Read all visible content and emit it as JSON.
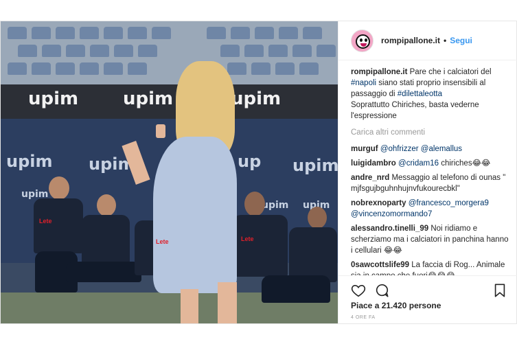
{
  "post": {
    "username": "rompipallone.it",
    "separator": "•",
    "follow_label": "Segui",
    "caption": {
      "username": "rompipallone.it",
      "text_1": "Pare che i calciatori del",
      "hashtag_1": "#napoli",
      "text_2": "siano stati proprio insensibili al passaggio di",
      "hashtag_2": "#dilettaleotta",
      "text_3": "Soprattutto Chiriches, basta vederne l'espressione"
    },
    "load_more_label": "Carica altri commenti",
    "comments": [
      {
        "user": "murguf",
        "mentions": [
          "@ohfrizzer",
          "@alemallus"
        ],
        "text": ""
      },
      {
        "user": "luigidambro",
        "mentions": [
          "@cridam16"
        ],
        "text": "chiriches😂😂"
      },
      {
        "user": "andre_nrd",
        "mentions": [],
        "text": "Messaggio al telefono di ounas \" mjfsgujbguhnhujnvfukourecbkl\""
      },
      {
        "user": "nobrexnoparty",
        "mentions": [
          "@francesco_morgera9",
          "@vincenzomormando7"
        ],
        "text": ""
      },
      {
        "user": "alessandro.tinelli_99",
        "mentions": [],
        "text": "Noi ridiamo e scherziamo ma i calciatori in panchina hanno i cellulari 😂😂"
      },
      {
        "user": "0sawcottslife99",
        "mentions": [],
        "text": "La faccia di Rog... Animale sia in campo che fuori😂😂😂"
      }
    ],
    "likes_text": "Piace a 21.420 persone",
    "time_text": "4 ORE FA"
  },
  "photo": {
    "roof_brand": [
      "upim",
      "upim",
      "upim"
    ],
    "bench_brand": [
      "upim",
      "upim",
      "upim",
      "up",
      "upim"
    ],
    "bench_brand_small": [
      "upim",
      "upim",
      "upim"
    ],
    "shirt_text": [
      "Lete",
      "Lete",
      "Lete"
    ]
  },
  "colors": {
    "link": "#003569",
    "follow": "#3897f0",
    "muted": "#999999"
  },
  "icons": [
    "heart-icon",
    "comment-icon",
    "bookmark-icon"
  ]
}
